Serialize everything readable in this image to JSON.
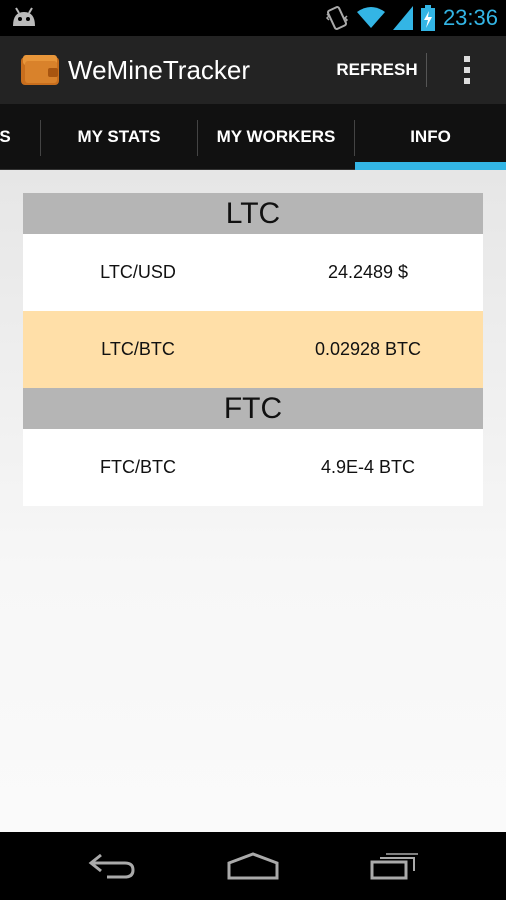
{
  "status_bar": {
    "time": "23:36"
  },
  "action_bar": {
    "title": "WeMineTracker",
    "refresh_label": "REFRESH"
  },
  "tabs": [
    {
      "label": "S"
    },
    {
      "label": "MY STATS"
    },
    {
      "label": "MY WORKERS"
    },
    {
      "label": "INFO",
      "selected": true
    }
  ],
  "sections": [
    {
      "header": "LTC",
      "rows": [
        {
          "pair": "LTC/USD",
          "value": "24.2489 $"
        },
        {
          "pair": "LTC/BTC",
          "value": "0.02928 BTC"
        }
      ]
    },
    {
      "header": "FTC",
      "rows": [
        {
          "pair": "FTC/BTC",
          "value": "4.9E-4 BTC"
        }
      ]
    }
  ],
  "colors": {
    "accent": "#33b5e5",
    "highlight_row": "#ffdfa8",
    "section_header": "#b5b5b5"
  }
}
